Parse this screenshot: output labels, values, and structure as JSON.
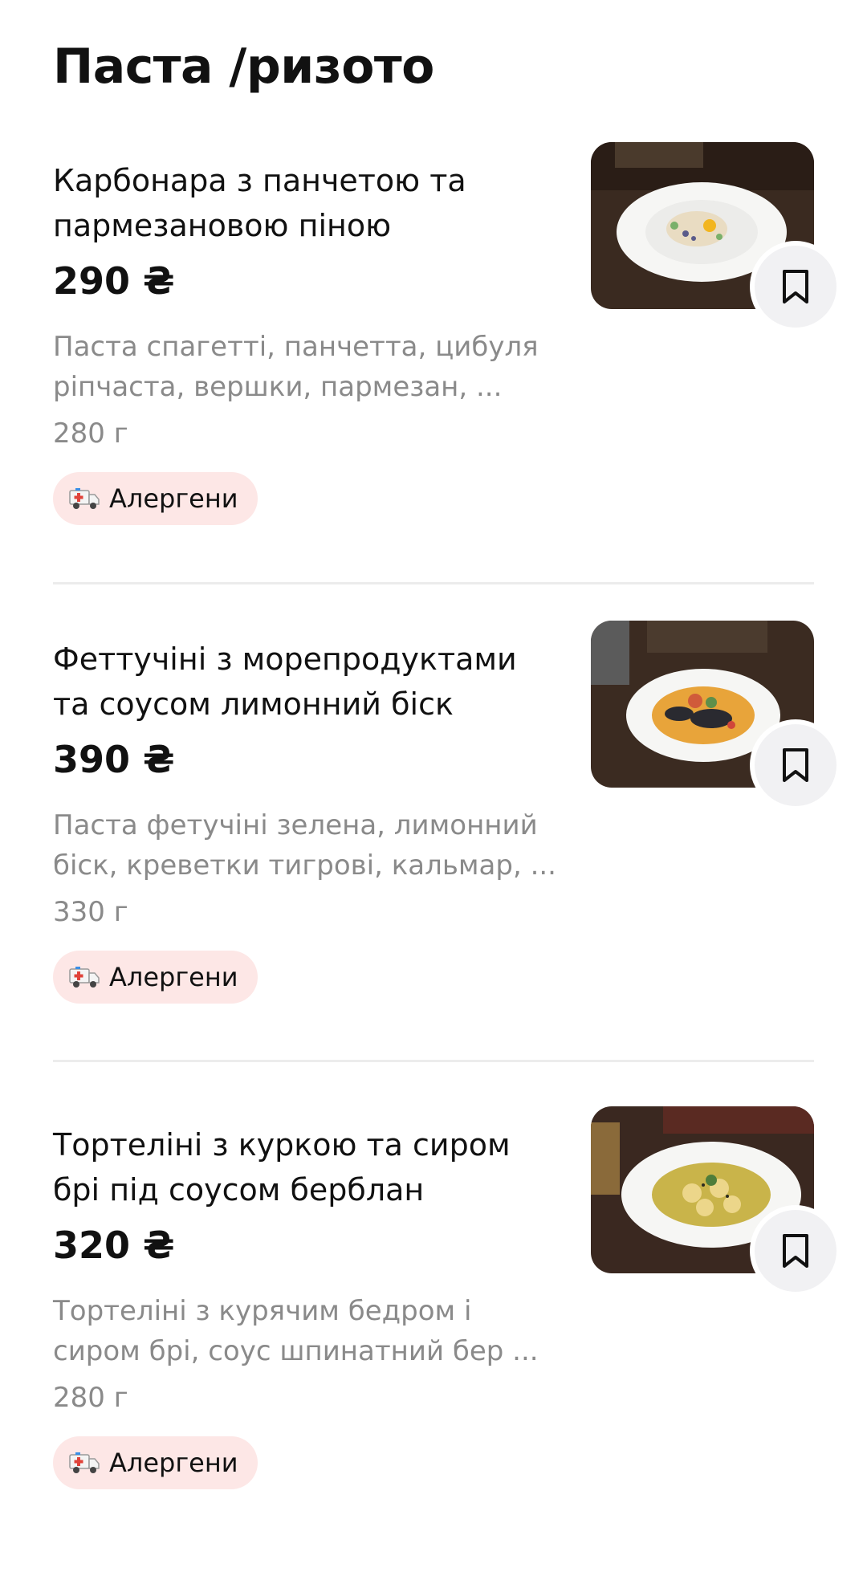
{
  "section": {
    "title": "Паста /ризото"
  },
  "colors": {
    "accent_chip_bg": "#fde7e6",
    "muted_text": "#8a8a8a",
    "bookmark_bg": "#f1f1f3"
  },
  "items": [
    {
      "name": "Карбонара з панчетою та пармезановою піною",
      "price": "290 ₴",
      "description": "Паста спагетті, панчетта, цибуля\nріпчаста, вершки, пармезан, ...",
      "weight": "280 г",
      "allergen_label": "Алергени",
      "photo_icon": "dish-photo",
      "bookmark_icon": "bookmark-icon"
    },
    {
      "name": "Феттучіні з морепродуктами та соусом лимонний біск",
      "price": "390 ₴",
      "description": "Паста фетучіні зелена, лимонний\nбіск, креветки тигрові, кальмар, ...",
      "weight": "330 г",
      "allergen_label": "Алергени",
      "photo_icon": "dish-photo",
      "bookmark_icon": "bookmark-icon"
    },
    {
      "name": "Тортеліні з куркою та сиром брі під соусом берблан",
      "price": "320 ₴",
      "description": "Тортеліні з курячим бедром і\nсиром брі, соус шпинатний бер ...",
      "weight": "280 г",
      "allergen_label": "Алергени",
      "photo_icon": "dish-photo",
      "bookmark_icon": "bookmark-icon"
    }
  ]
}
